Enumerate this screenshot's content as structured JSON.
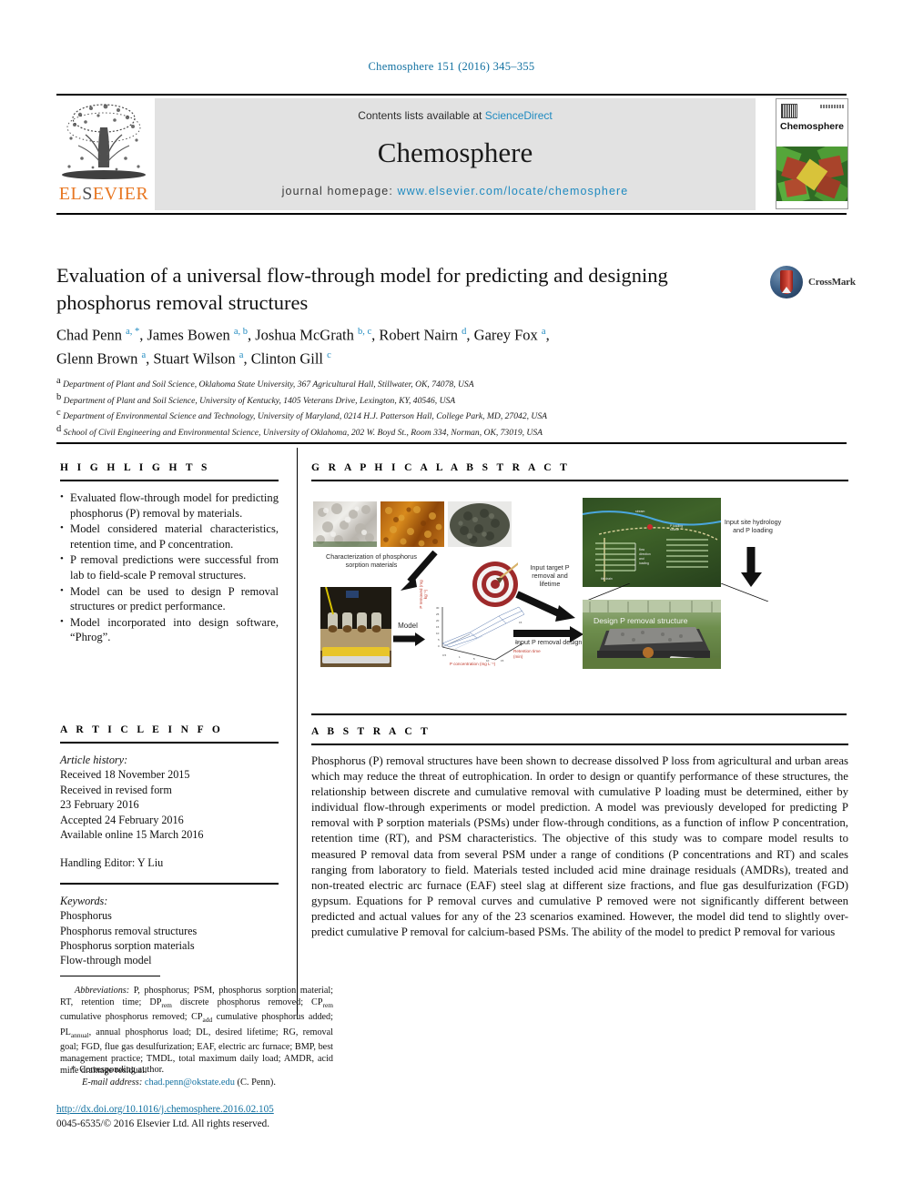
{
  "running_head": "Chemosphere 151 (2016) 345–355",
  "masthead": {
    "contents_prefix": "Contents lists available at ",
    "contents_link": "ScienceDirect",
    "journal_name": "Chemosphere",
    "homepage_prefix": "journal homepage: ",
    "homepage_url": "www.elsevier.com/locate/chemosphere",
    "publisher": "ELSEVIER",
    "publisher_logo_alt": "elsevier-tree-logo",
    "cover_title": "Chemosphere"
  },
  "article": {
    "title": "Evaluation of a universal flow-through model for predicting and designing phosphorus removal structures",
    "crossmark_label": "CrossMark",
    "authors_line1": "Chad Penn <sup>a, *</sup>, James Bowen <sup>a, b</sup>, Joshua McGrath <sup>b, c</sup>, Robert Nairn <sup>d</sup>, Garey Fox <sup>a</sup>,",
    "authors_line2": "Glenn Brown <sup>a</sup>, Stuart Wilson <sup>a</sup>, Clinton Gill <sup>c</sup>",
    "affiliations": [
      {
        "mark": "a",
        "text": "Department of Plant and Soil Science, Oklahoma State University, 367 Agricultural Hall, Stillwater, OK, 74078, USA"
      },
      {
        "mark": "b",
        "text": "Department of Plant and Soil Science, University of Kentucky, 1405 Veterans Drive, Lexington, KY, 40546, USA"
      },
      {
        "mark": "c",
        "text": "Department of Environmental Science and Technology, University of Maryland, 0214 H.J. Patterson Hall, College Park, MD, 27042, USA"
      },
      {
        "mark": "d",
        "text": "School of Civil Engineering and Environmental Science, University of Oklahoma, 202 W. Boyd St., Room 334, Norman, OK, 73019, USA"
      }
    ]
  },
  "highlights": {
    "heading": "H I G H L I G H T S",
    "items": [
      "Evaluated flow-through model for predicting phosphorus (P) removal by materials.",
      "Model considered material characteristics, retention time, and P concentration.",
      "P removal predictions were successful from lab to field-scale P removal structures.",
      "Model can be used to design P removal structures or predict performance.",
      "Model incorporated into design software, “Phrog”."
    ]
  },
  "article_info": {
    "heading": "A R T I C L E   I N F O",
    "history_label": "Article history:",
    "history": [
      "Received 18 November 2015",
      "Received in revised form",
      "23 February 2016",
      "Accepted 24 February 2016",
      "Available online 15 March 2016"
    ],
    "handling_editor": "Handling Editor: Y Liu",
    "keywords_label": "Keywords:",
    "keywords": [
      "Phosphorus",
      "Phosphorus removal structures",
      "Phosphorus sorption materials",
      "Flow-through model"
    ]
  },
  "graphical_abstract": {
    "heading": "G R A P H I C A L   A B S T R A C T",
    "labels": {
      "characterization": "Characterization of phosphorus sorption materials",
      "model": "Model",
      "target": "Input target P removal and lifetime",
      "design_curve": "Input P removal design curve",
      "site_hydrology": "Input site hydrology and P loading",
      "design_structure": "Design P removal structure"
    },
    "chart_axes": {
      "y": "P removed (mg kg⁻¹)",
      "x": "P concentration (mg L⁻¹)",
      "z": "Retention time (min)"
    }
  },
  "abstract": {
    "heading": "A B S T R A C T",
    "text": "Phosphorus (P) removal structures have been shown to decrease dissolved P loss from agricultural and urban areas which may reduce the threat of eutrophication. In order to design or quantify performance of these structures, the relationship between discrete and cumulative removal with cumulative P loading must be determined, either by individual flow-through experiments or model prediction. A model was previously developed for predicting P removal with P sorption materials (PSMs) under flow-through conditions, as a function of inflow P concentration, retention time (RT), and PSM characteristics. The objective of this study was to compare model results to measured P removal data from several PSM under a range of conditions (P concentrations and RT) and scales ranging from laboratory to field. Materials tested included acid mine drainage residuals (AMDRs), treated and non-treated electric arc furnace (EAF) steel slag at different size fractions, and flue gas desulfurization (FGD) gypsum. Equations for P removal curves and cumulative P removed were not significantly different between predicted and actual values for any of the 23 scenarios examined. However, the model did tend to slightly over-predict cumulative P removal for calcium-based PSMs. The ability of the model to predict P removal for various"
  },
  "footnotes": {
    "abbreviations_label": "Abbreviations:",
    "abbreviations_text": " P, phosphorus; PSM, phosphorus sorption material; RT, retention time; DP<sub>rem</sub> discrete phosphorus removed; CP<sub>rem</sub> cumulative phosphorus removed; CP<sub>add</sub> cumulative phosphorus added; PL<sub>annual</sub>, annual phosphorus load; DL, desired lifetime; RG, removal goal; FGD, flue gas desulfurization; EAF, electric arc furnace; BMP, best management practice; TMDL, total maximum daily load; AMDR, acid mine drainage residual.",
    "corresponding_author": "Corresponding author.",
    "email_label": "E-mail address:",
    "email": "chad.penn@okstate.edu",
    "email_suffix": " (C. Penn).",
    "doi_url": "http://dx.doi.org/10.1016/j.chemosphere.2016.02.105",
    "copyright": "0045-6535/© 2016 Elsevier Ltd. All rights reserved."
  },
  "colors": {
    "link": "#1170a0",
    "science_direct": "#1f8ac0",
    "elsevier_orange": "#e87722",
    "band_gray": "#e2e2e2"
  }
}
